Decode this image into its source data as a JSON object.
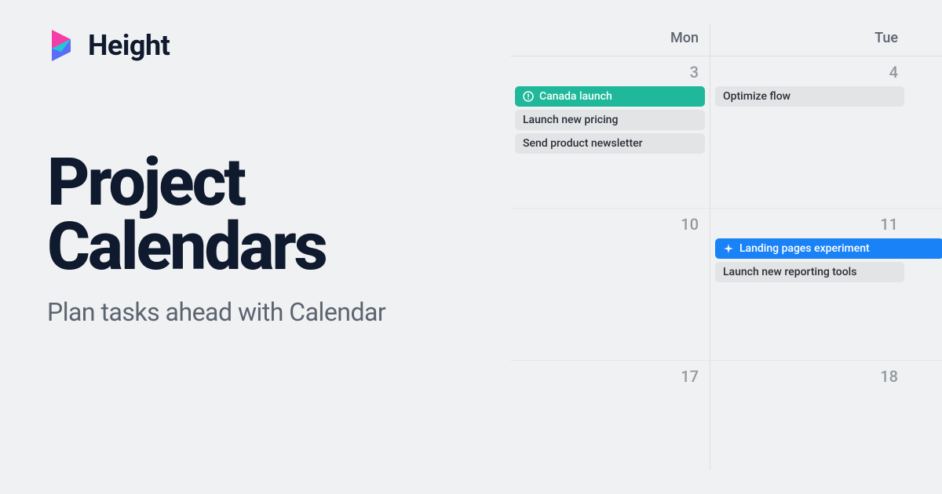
{
  "brand": {
    "name": "Height"
  },
  "hero": {
    "title_line1": "Project",
    "title_line2": "Calendars",
    "subtitle": "Plan tasks ahead with Calendar"
  },
  "calendar": {
    "columns": [
      {
        "label": "Mon"
      },
      {
        "label": "Tue"
      }
    ],
    "weeks": [
      {
        "days": [
          {
            "number": "3",
            "events": [
              {
                "label": "Canada launch",
                "color": "teal",
                "icon": "alert-circle"
              },
              {
                "label": "Launch new pricing",
                "color": "gray",
                "icon": null
              },
              {
                "label": "Send product newsletter",
                "color": "gray",
                "icon": null
              }
            ]
          },
          {
            "number": "4",
            "events": [
              {
                "label": "Optimize flow",
                "color": "gray",
                "icon": null
              }
            ]
          }
        ]
      },
      {
        "days": [
          {
            "number": "10",
            "events": []
          },
          {
            "number": "11",
            "events": [
              {
                "label": "Landing pages experiment",
                "color": "blue",
                "icon": "sparkle"
              },
              {
                "label": "Launch new reporting tools",
                "color": "gray",
                "icon": null
              }
            ]
          }
        ]
      },
      {
        "days": [
          {
            "number": "17",
            "events": []
          },
          {
            "number": "18",
            "events": []
          }
        ]
      }
    ]
  }
}
